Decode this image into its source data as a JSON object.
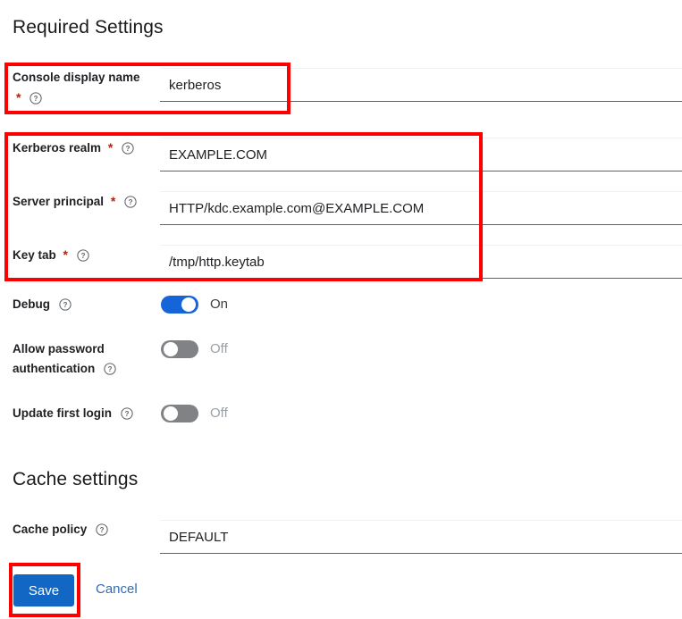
{
  "sections": {
    "required": {
      "title": "Required Settings"
    },
    "cache": {
      "title": "Cache settings"
    }
  },
  "fields": {
    "console_display_name": {
      "label": "Console display name",
      "required_marker": "*",
      "value": "kerberos",
      "help_icon": "help-circle-icon"
    },
    "kerberos_realm": {
      "label": "Kerberos realm",
      "required_marker": "*",
      "value": "EXAMPLE.COM",
      "help_icon": "help-circle-icon"
    },
    "server_principal": {
      "label": "Server principal",
      "required_marker": "*",
      "value": "HTTP/kdc.example.com@EXAMPLE.COM",
      "help_icon": "help-circle-icon"
    },
    "key_tab": {
      "label": "Key tab",
      "required_marker": "*",
      "value": "/tmp/http.keytab",
      "help_icon": "help-circle-icon"
    },
    "cache_policy": {
      "label": "Cache policy",
      "value": "DEFAULT",
      "help_icon": "help-circle-icon"
    }
  },
  "toggles": {
    "debug": {
      "label": "Debug",
      "state_label": "On",
      "on": true,
      "help_icon": "help-circle-icon"
    },
    "allow_password_authentication": {
      "label_line1": "Allow password",
      "label_line2": "authentication",
      "state_label": "Off",
      "on": false,
      "help_icon": "help-circle-icon"
    },
    "update_first_login": {
      "label": "Update first login",
      "state_label": "Off",
      "on": false,
      "help_icon": "help-circle-icon"
    }
  },
  "actions": {
    "save_label": "Save",
    "cancel_label": "Cancel"
  },
  "colors": {
    "accent_blue": "#1267c4",
    "toggle_on": "#1565d8",
    "toggle_off": "#808285",
    "required_asterisk": "#a52714",
    "link": "#2f6cb5",
    "annotation_red": "#ff0000"
  }
}
